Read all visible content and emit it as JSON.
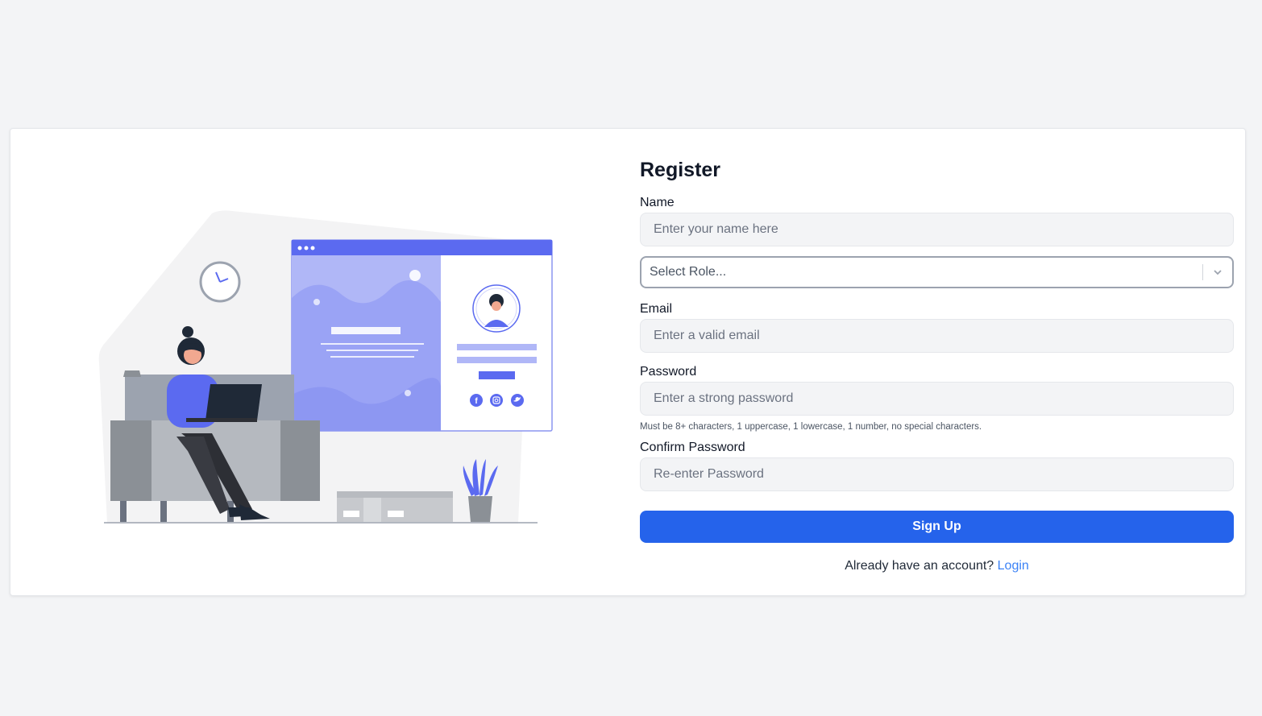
{
  "register": {
    "title": "Register",
    "name": {
      "label": "Name",
      "placeholder": "Enter your name here"
    },
    "role": {
      "placeholder": "Select Role..."
    },
    "email": {
      "label": "Email",
      "placeholder": "Enter a valid email"
    },
    "password": {
      "label": "Password",
      "placeholder": "Enter a strong password",
      "hint": "Must be 8+ characters, 1 uppercase, 1 lowercase, 1 number, no special characters."
    },
    "confirm_password": {
      "label": "Confirm Password",
      "placeholder": "Re-enter Password"
    },
    "submit_label": "Sign Up",
    "footer_prompt": "Already have an account?",
    "login_link": "Login"
  },
  "colors": {
    "accent": "#2563eb",
    "illustration_accent": "#5b6af0",
    "background": "#f3f4f6"
  },
  "icons": [
    "clock-icon",
    "facebook-icon",
    "instagram-icon",
    "twitter-icon",
    "chevron-down-icon"
  ]
}
